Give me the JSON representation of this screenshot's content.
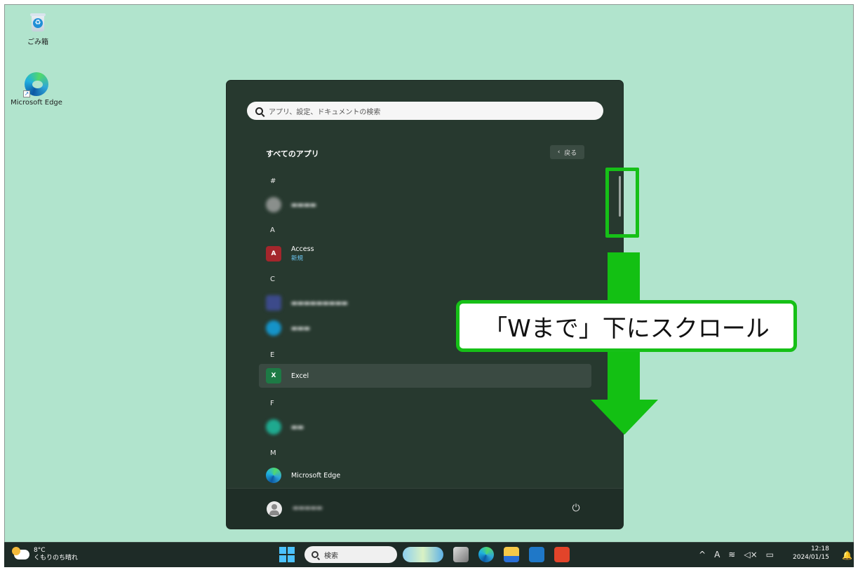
{
  "desktop": {
    "icons": [
      {
        "label": "ごみ箱",
        "icon": "recycle-bin-icon"
      },
      {
        "label": "Microsoft Edge",
        "icon": "edge-icon"
      }
    ]
  },
  "start_menu": {
    "search_placeholder": "アプリ、設定、ドキュメントの検索",
    "title": "すべてのアプリ",
    "back_label": "戻る",
    "letters": [
      "#",
      "A",
      "C",
      "E",
      "F",
      "M"
    ],
    "apps": [
      {
        "name": "電卓 (blurred)",
        "blurred": true
      },
      {
        "name": "Access",
        "sub": "新規",
        "icon_color": "#a4262c"
      },
      {
        "name": "Clipchamp (blurred)",
        "blurred": true
      },
      {
        "name": "Cortana (blurred)",
        "blurred": true
      },
      {
        "name": "Excel",
        "icon_color": "#1d7a45",
        "highlighted": true
      },
      {
        "name": "Family (blurred)",
        "blurred": true
      },
      {
        "name": "Microsoft Edge"
      }
    ],
    "user_name": "(blurred)"
  },
  "annotation": {
    "callout_text": "「Wまで」下にスクロール",
    "color": "#16c017"
  },
  "taskbar": {
    "weather_temp": "8°C",
    "weather_desc": "くもりのち晴れ",
    "search_label": "検索",
    "time": "12:18",
    "date": "2024/01/15",
    "ime": "A"
  }
}
